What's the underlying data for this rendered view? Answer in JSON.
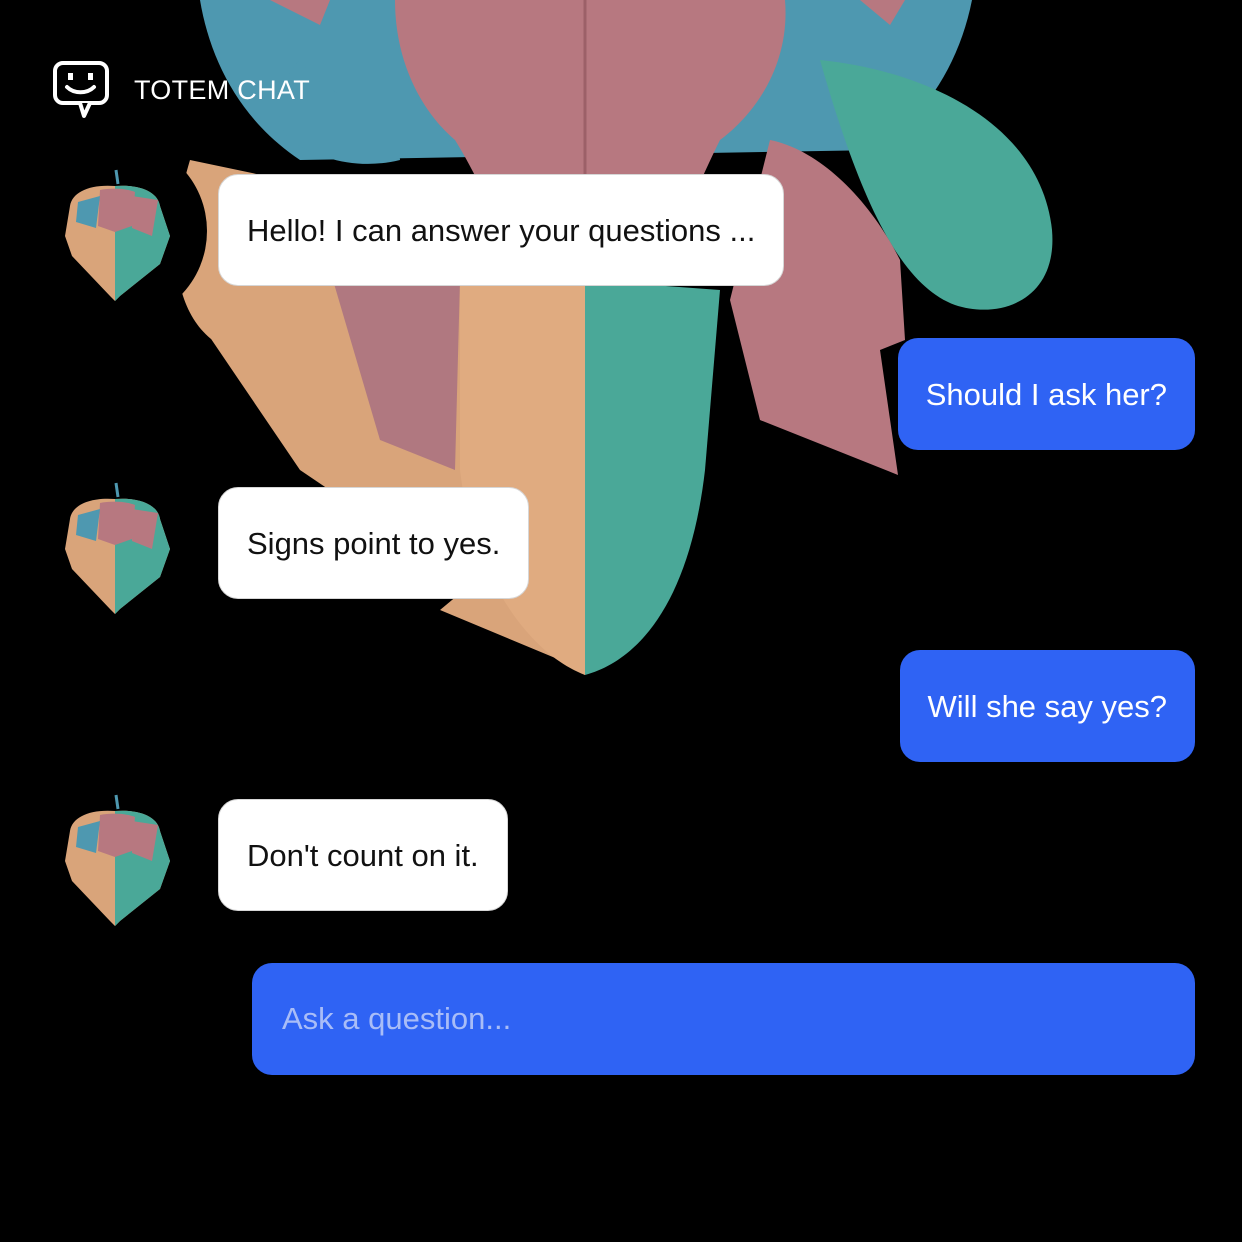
{
  "app": {
    "title": "TOTEM CHAT",
    "logo_icon": "chat-smiley-icon",
    "avatar_icon": "totem-avatar-icon",
    "background_art": "totem-illustration"
  },
  "colors": {
    "background": "#000000",
    "user_bubble": "#2f63f4",
    "bot_bubble": "#ffffff",
    "totem_pink": "#b77880",
    "totem_teal": "#4aa898",
    "totem_tan": "#d9a47a",
    "totem_blue": "#4e98b0"
  },
  "messages": [
    {
      "sender": "bot",
      "text": "Hello! I can answer your questions ..."
    },
    {
      "sender": "user",
      "text": "Should I ask her?"
    },
    {
      "sender": "bot",
      "text": "Signs point to yes."
    },
    {
      "sender": "user",
      "text": "Will she say yes?"
    },
    {
      "sender": "bot",
      "text": "Don't count on it."
    }
  ],
  "composer": {
    "placeholder": "Ask a question..."
  }
}
